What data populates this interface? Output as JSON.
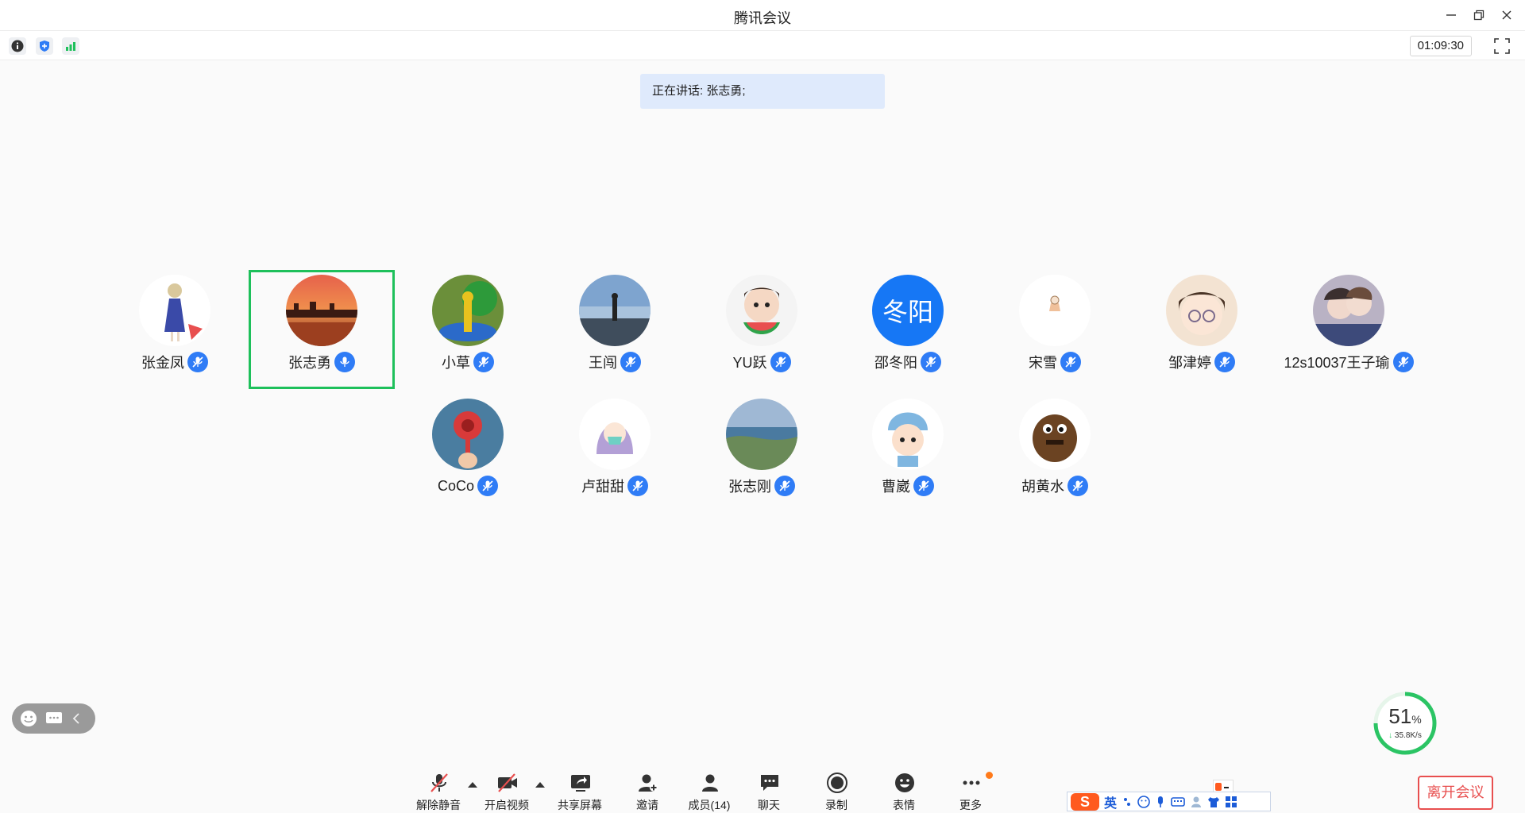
{
  "window": {
    "title": "腾讯会议"
  },
  "infobar": {
    "timer": "01:09:30"
  },
  "speaking": {
    "text": "正在讲话: 张志勇;"
  },
  "participants": [
    {
      "name": "张金凤"
    },
    {
      "name": "张志勇",
      "speaking": true
    },
    {
      "name": "小草"
    },
    {
      "name": "王闯"
    },
    {
      "name": "YU跃"
    },
    {
      "name": "邵冬阳",
      "avatar_text": "冬阳"
    },
    {
      "name": "宋雪"
    },
    {
      "name": "邹津婷"
    },
    {
      "name": "12s10037王子瑜"
    },
    {
      "name": "CoCo"
    },
    {
      "name": "卢甜甜"
    },
    {
      "name": "张志刚"
    },
    {
      "name": "曹崴"
    },
    {
      "name": "胡黄水"
    }
  ],
  "network": {
    "percent": "51",
    "unit": "%",
    "speed": "35.8K/s"
  },
  "toolbar": {
    "unmute": "解除静音",
    "video": "开启视频",
    "share": "共享屏幕",
    "invite": "邀请",
    "members": "成员(14)",
    "chat": "聊天",
    "record": "录制",
    "emoji": "表情",
    "more": "更多",
    "leave": "离开会议"
  },
  "ime": {
    "mode": "英"
  },
  "colors": {
    "accent": "#2f7cf6",
    "active_border": "#1ec05b",
    "leave": "#e84f4f"
  }
}
